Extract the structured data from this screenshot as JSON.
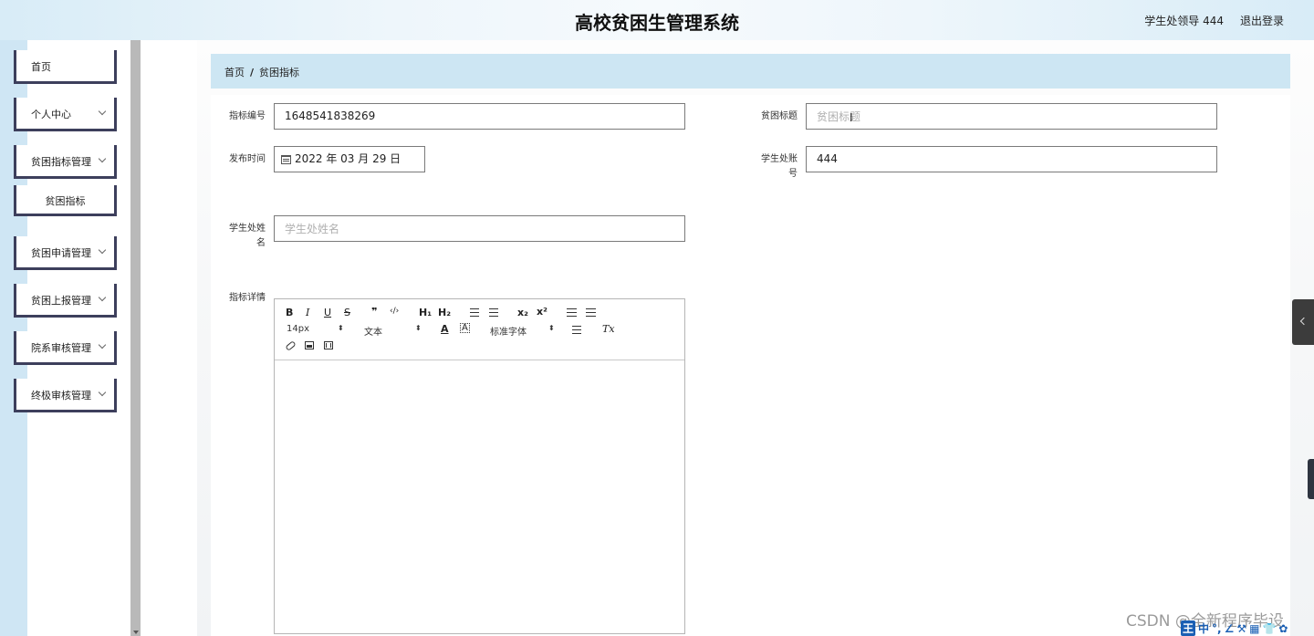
{
  "header": {
    "app_title": "高校贫困生管理系统",
    "user_label": "学生处领导 444",
    "logout_label": "退出登录"
  },
  "sidebar": {
    "items": [
      {
        "label": "首页",
        "has_arrow": false
      },
      {
        "label": "个人中心",
        "has_arrow": true
      },
      {
        "label": "贫困指标管理",
        "has_arrow": true
      },
      {
        "label": "贫困指标",
        "submenu": true
      },
      {
        "label": "贫困申请管理",
        "has_arrow": true
      },
      {
        "label": "贫困上报管理",
        "has_arrow": true
      },
      {
        "label": "院系审核管理",
        "has_arrow": true
      },
      {
        "label": "终极审核管理",
        "has_arrow": true
      }
    ]
  },
  "breadcrumb": {
    "home": "首页",
    "separator": "/",
    "current": "贫困指标"
  },
  "form": {
    "indicator_no": {
      "label": "指标编号",
      "value": "1648541838269"
    },
    "title": {
      "label": "贫困标题",
      "value": "",
      "placeholder": "贫困标题"
    },
    "publish_time": {
      "label": "发布时间",
      "value": "2022 年 03 月 29 日"
    },
    "student_account": {
      "label_line1": "学生处账",
      "label_line2": "号",
      "value": "444"
    },
    "student_name": {
      "label_line1": "学生处姓",
      "label_line2": "名",
      "value": "",
      "placeholder": "学生处姓名"
    },
    "details": {
      "label": "指标详情"
    }
  },
  "editor": {
    "toolbar": {
      "bold": "B",
      "italic": "I",
      "underline": "U",
      "strike": "S",
      "quote": "❞",
      "code": "‹/›",
      "h1": "H₁",
      "h2": "H₂",
      "sub": "x₂",
      "sup": "x²",
      "size_select": "14px",
      "type_select": "文本",
      "color": "A",
      "bg": "A",
      "font_select": "标准字体",
      "clear": "Tx",
      "updown": "⬍"
    }
  },
  "watermark": "CSDN @全新程序毕设",
  "ime": [
    "中",
    "°,",
    "∠",
    "⚒",
    "▦",
    "👕",
    "✿"
  ],
  "ime_logo": "王"
}
